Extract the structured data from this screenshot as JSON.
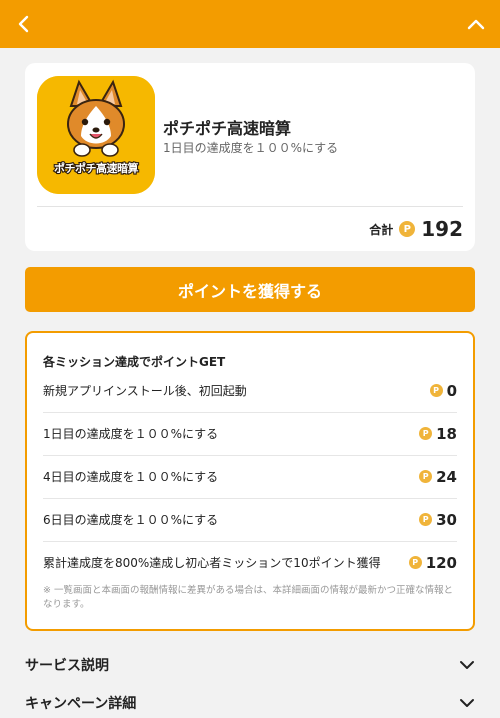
{
  "header": {
    "back_icon": "chevron-left-icon",
    "collapse_icon": "chevron-up-icon",
    "bg": "#f39c00"
  },
  "app": {
    "icon_text": "ポチポチ高速暗算",
    "name": "ポチポチ高速暗算",
    "subtitle": "1日目の達成度を１００%にする",
    "total_label": "合計",
    "total_points": "192"
  },
  "cta": {
    "label": "ポイントを獲得する"
  },
  "missions": {
    "heading": "各ミッション達成でポイントGET",
    "items": [
      {
        "label": "新規アプリインストール後、初回起動",
        "points": "0"
      },
      {
        "label": "1日目の達成度を１００%にする",
        "points": "18"
      },
      {
        "label": "4日目の達成度を１００%にする",
        "points": "24"
      },
      {
        "label": "6日目の達成度を１００%にする",
        "points": "30"
      },
      {
        "label": "累計達成度を800%達成し初心者ミッションで10ポイント獲得",
        "points": "120"
      }
    ],
    "note": "※ 一覧画面と本画面の報酬情報に差異がある場合は、本詳細画面の情報が最新かつ正確な情報となります。"
  },
  "coin_glyph": "P",
  "sections": [
    {
      "label": "サービス説明"
    },
    {
      "label": "キャンペーン詳細"
    }
  ]
}
